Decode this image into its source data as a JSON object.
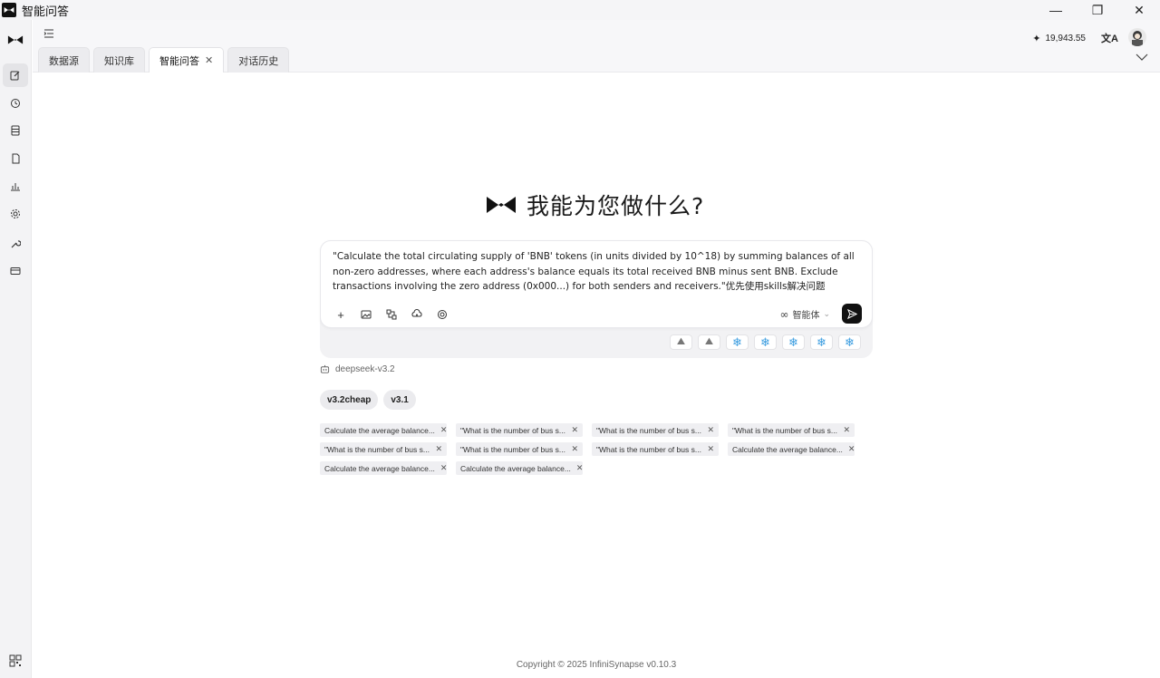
{
  "window": {
    "title": "智能问答",
    "minimize_glyph": "—",
    "maximize_glyph": "❐",
    "close_glyph": "✕"
  },
  "sidebar": {
    "items": [
      {
        "name": "new-chat-icon",
        "active": true
      },
      {
        "name": "history-icon",
        "active": false
      },
      {
        "name": "database-icon",
        "active": false
      },
      {
        "name": "document-icon",
        "active": false
      },
      {
        "name": "chart-icon",
        "active": false
      },
      {
        "name": "settings-icon",
        "active": false
      },
      {
        "name": "wrench-icon",
        "active": false
      },
      {
        "name": "card-icon",
        "active": false
      }
    ],
    "bottom_icon": "qr-code-icon"
  },
  "header": {
    "tabs": [
      {
        "label": "数据源",
        "active": false,
        "closable": false
      },
      {
        "label": "知识库",
        "active": false,
        "closable": false
      },
      {
        "label": "智能问答",
        "active": true,
        "closable": true
      },
      {
        "label": "对话历史",
        "active": false,
        "closable": false
      }
    ],
    "tab_close_glyph": "✕",
    "credits": "19,943.55",
    "spark_glyph": "✦",
    "translate_glyph": "文A"
  },
  "main": {
    "hero_title": "我能为您做什么?",
    "prompt": "\"Calculate the total circulating supply of 'BNB' tokens (in units divided by 10^18) by summing balances of all non-zero addresses, where each address's balance equals its total received BNB minus sent BNB. Exclude transactions involving the zero address (0x000...) for both senders and receivers.\"优先使用skills解决问题",
    "agent_label": "智能体",
    "agent_glyph": "∞",
    "chevron_glyph": "⌄",
    "add_glyph": "+",
    "skill_glyph_mountain": "⛰",
    "skill_glyph_snow": "❄",
    "model": "deepseek-v3.2",
    "versions": [
      "v3.2cheap",
      "v3.1"
    ],
    "history": [
      "Calculate the average balance...",
      "\"What is the number of bus s...",
      "\"What is the number of bus s...",
      "\"What is the number of bus s...",
      "\"What is the number of bus s...",
      "\"What is the number of bus s...",
      "\"What is the number of bus s...",
      "Calculate the average balance...",
      "Calculate the average balance...",
      "Calculate the average balance..."
    ],
    "history_close_glyph": "✕",
    "copyright": "Copyright © 2025 InfiniSynapse v0.10.3"
  },
  "colors": {
    "accent": "#111111",
    "skill_blue": "#3b9de0",
    "chip_bg": "#efeff2"
  }
}
